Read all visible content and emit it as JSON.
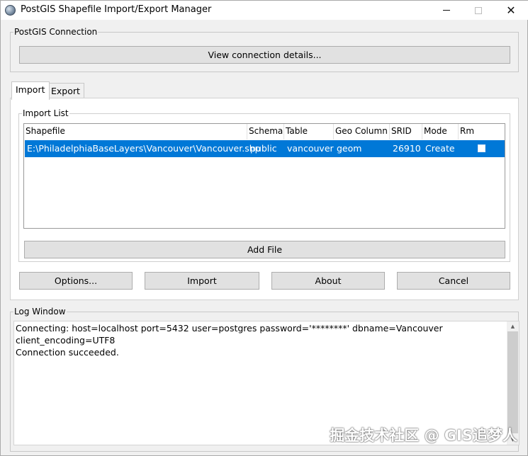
{
  "window": {
    "title": "PostGIS Shapefile Import/Export Manager",
    "minimize_icon": "minimize-icon",
    "maximize_icon": "maximize-icon",
    "close_icon": "close-icon",
    "close_glyph": "✕"
  },
  "connection": {
    "group_label": "PostGIS Connection",
    "view_button": "View connection details..."
  },
  "tabs": [
    {
      "label": "Import",
      "active": true
    },
    {
      "label": "Export",
      "active": false
    }
  ],
  "import_list": {
    "group_label": "Import List",
    "columns": [
      "Shapefile",
      "Schema",
      "Table",
      "Geo Column",
      "SRID",
      "Mode",
      "Rm"
    ],
    "rows": [
      {
        "shapefile": "E:\\PhiladelphiaBaseLayers\\Vancouver\\Vancouver.shp",
        "schema": "public",
        "table": "vancouver",
        "geo_column": "geom",
        "srid": "26910",
        "mode": "Create",
        "rm": false,
        "selected": true
      }
    ],
    "add_file_button": "Add File"
  },
  "actions": {
    "options": "Options...",
    "import": "Import",
    "about": "About",
    "cancel": "Cancel"
  },
  "log": {
    "group_label": "Log Window",
    "lines": [
      "Connecting:  host=localhost port=5432 user=postgres password='********' dbname=Vancouver",
      "client_encoding=UTF8",
      "Connection succeeded."
    ]
  },
  "watermark": "掘金技术社区 @ GIS追梦人",
  "colors": {
    "selection": "#0078d7",
    "button_face": "#e1e1e1",
    "window_bg": "#f0f0f0"
  }
}
